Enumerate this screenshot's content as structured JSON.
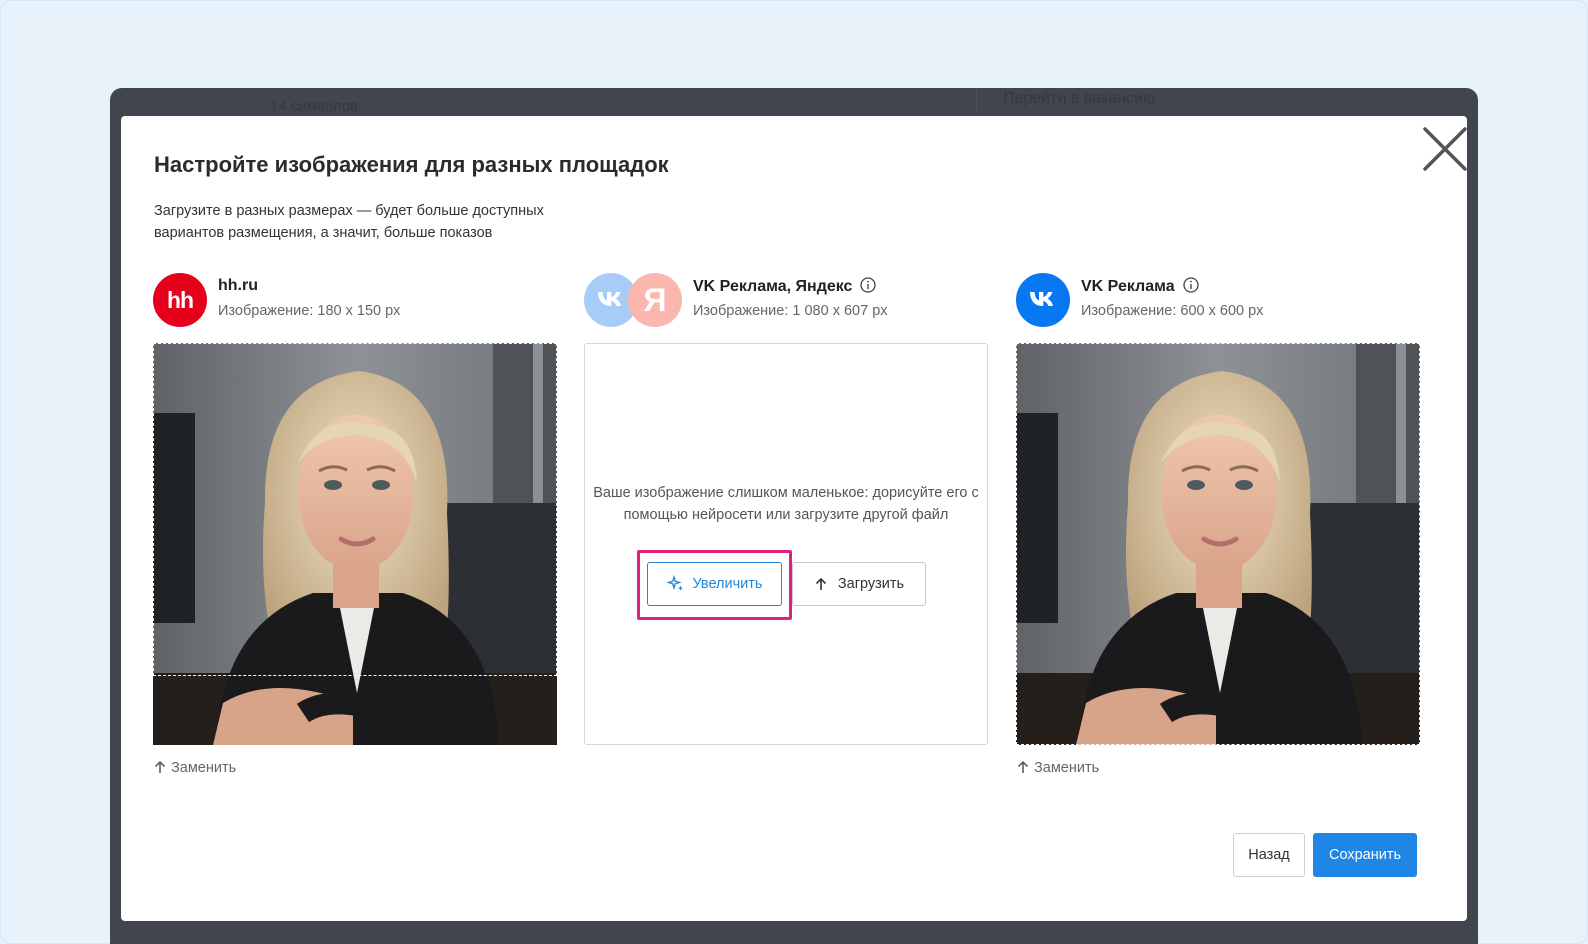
{
  "background": {
    "char_count": "14 символов",
    "vacancy_link": "Перейти в вакансию"
  },
  "modal": {
    "title": "Настройте изображения для разных площадок",
    "subtitle": "Загрузите в разных размерах — будет больше доступных вариантов размещения, а значит, больше показов",
    "close_icon": "close-icon"
  },
  "columns": [
    {
      "name": "hh.ru",
      "size": "Изображение: 180 x 150 px",
      "logo_text": "hh",
      "logo_color": "#e5001c",
      "replace_label": "Заменить"
    },
    {
      "name": "VK Реклама, Яндекс",
      "size": "Изображение: 1 080 x 607 px",
      "logo_vk_color": "#a8ccf8",
      "logo_ya_color": "#fbb6ae",
      "message": "Ваше изображение слишком маленькое: дорисуйте его с помощью нейросети или загрузите другой файл",
      "enlarge_label": "Увеличить",
      "upload_label": "Загрузить"
    },
    {
      "name": "VK Реклама",
      "size": "Изображение: 600 x 600 px",
      "logo_color": "#0877f2",
      "replace_label": "Заменить"
    }
  ],
  "footer": {
    "back_label": "Назад",
    "save_label": "Сохранить"
  },
  "colors": {
    "accent": "#1f86e5",
    "highlight": "#e0227e"
  }
}
